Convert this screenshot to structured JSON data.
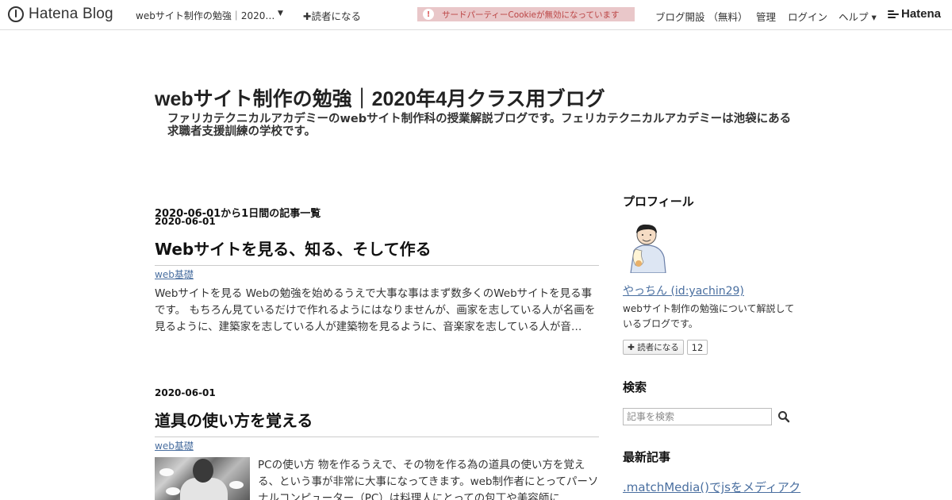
{
  "topbar": {
    "logo_text": "Hatena Blog",
    "blog_name": "webサイト制作の勉強｜2020…",
    "subscribe_label": "✚読者になる",
    "cookie_warning": "サードパーティーCookieが無効になっています",
    "cookie_icon": "!",
    "nav": {
      "open_blog": "ブログ開設 （無料）",
      "admin": "管理",
      "login": "ログイン",
      "help": "ヘルプ ▾"
    },
    "hatena_text": "Hatena"
  },
  "blog": {
    "title": "webサイト制作の勉強｜2020年4月クラス用ブログ",
    "description": "ファリカテクニカルアカデミーのwebサイト制作科の授業解説ブログです。フェリカテクニカルアカデミーは池袋にある求職者支援訓練の学校です。"
  },
  "archive": {
    "heading": "2020-06-01から1日間の記事一覧",
    "entries": [
      {
        "date": "2020-06-01",
        "title": "Webサイトを見る、知る、そして作る",
        "category": "web基礎",
        "excerpt": "Webサイトを見る Webの勉強を始めるうえで大事な事はまず数多くのWebサイトを見る事です。 もちろん見ているだけで作れるようにはなりませんが、画家を志している人が名画を見るように、建築家を志している人が建築物を見るように、音楽家を志している人が音…"
      },
      {
        "date": "2020-06-01",
        "title": "道具の使い方を覚える",
        "category": "web基礎",
        "excerpt": "PCの使い方 物を作るうえで、その物を作る為の道具の使い方を覚える、という事が非常に大事になってきます。web制作者にとってパーソナルコンピューター（PC）は料理人にとっての包丁や美容師に"
      }
    ]
  },
  "sidebar": {
    "profile": {
      "heading": "プロフィール",
      "name": "やっちん (id:yachin29)",
      "description": "webサイト制作の勉強について解説しているブログです。",
      "subscribe_label": "✚ 読者になる",
      "subscriber_count": "12"
    },
    "search": {
      "heading": "検索",
      "placeholder": "記事を検索"
    },
    "recent": {
      "heading": "最新記事",
      "first_link": ".matchMedia()でjsをメディアク"
    }
  }
}
